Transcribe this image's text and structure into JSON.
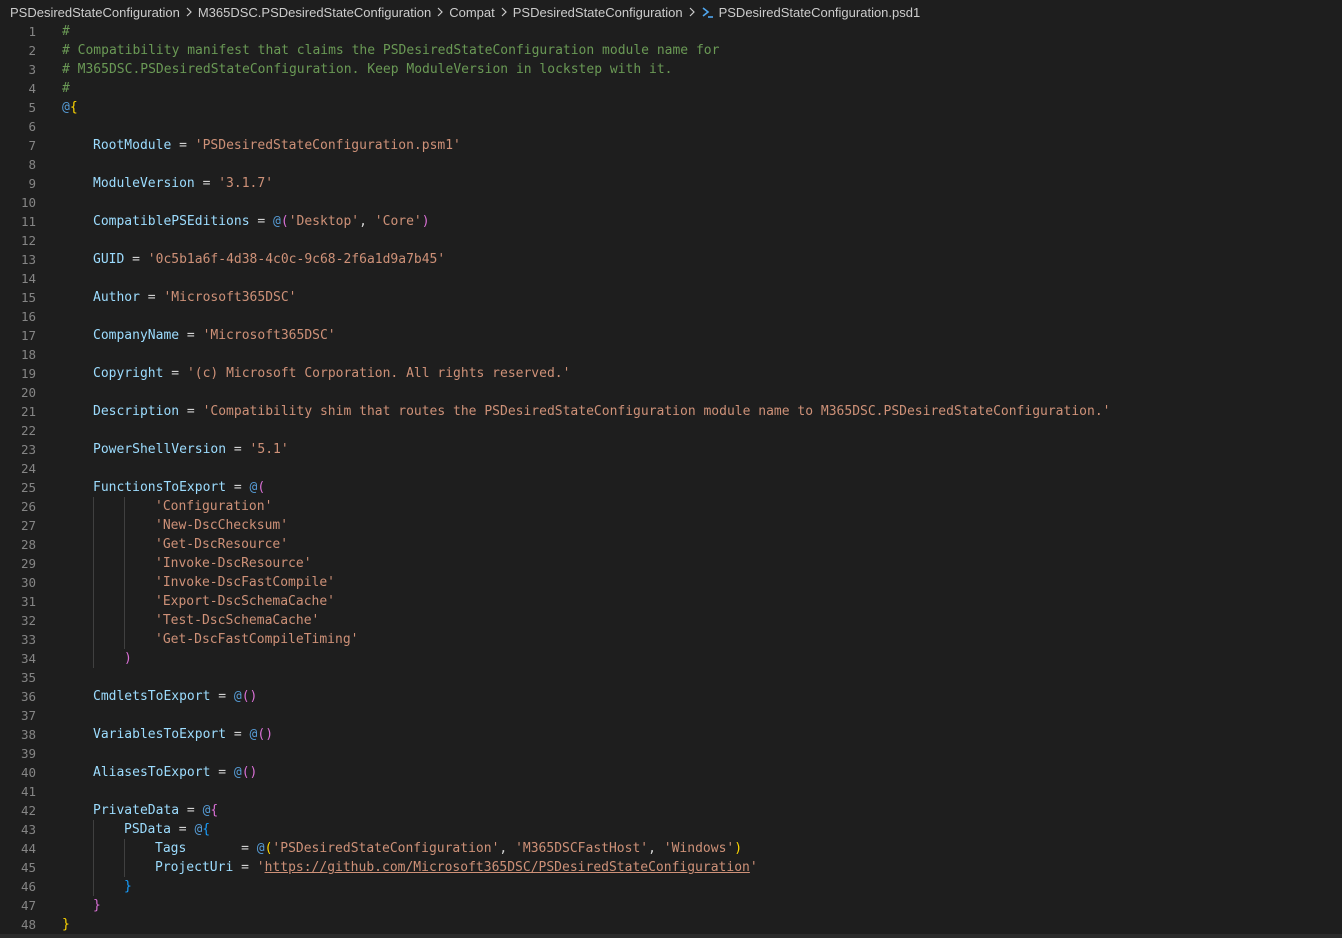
{
  "breadcrumb": {
    "items": [
      "PSDesiredStateConfiguration",
      "M365DSC.PSDesiredStateConfiguration",
      "Compat",
      "PSDesiredStateConfiguration"
    ],
    "file": "PSDesiredStateConfiguration.psd1",
    "file_icon": "powershell-icon"
  },
  "colors": {
    "background": "#1e1e1e",
    "comment": "#6a9955",
    "key": "#9cdcfe",
    "string": "#ce9178",
    "bracket_level1": "#ffd700",
    "bracket_level2": "#da70d6",
    "bracket_level3": "#179fff",
    "line_number": "#858585"
  },
  "editor": {
    "lines": [
      {
        "n": "1",
        "tokens": [
          [
            "c",
            "#"
          ]
        ]
      },
      {
        "n": "2",
        "tokens": [
          [
            "c",
            "# Compatibility manifest that claims the PSDesiredStateConfiguration module name for"
          ]
        ]
      },
      {
        "n": "3",
        "tokens": [
          [
            "c",
            "# M365DSC.PSDesiredStateConfiguration. Keep ModuleVersion in lockstep with it."
          ]
        ]
      },
      {
        "n": "4",
        "tokens": [
          [
            "c",
            "#"
          ]
        ]
      },
      {
        "n": "5",
        "tokens": [
          [
            "a",
            "@"
          ],
          [
            "b1",
            "{"
          ]
        ]
      },
      {
        "n": "6",
        "tokens": []
      },
      {
        "n": "7",
        "indent": 1,
        "tokens": [
          [
            "k",
            "RootModule"
          ],
          [
            "o",
            " = "
          ],
          [
            "s",
            "'PSDesiredStateConfiguration.psm1'"
          ]
        ]
      },
      {
        "n": "8",
        "tokens": []
      },
      {
        "n": "9",
        "indent": 1,
        "tokens": [
          [
            "k",
            "ModuleVersion"
          ],
          [
            "o",
            " = "
          ],
          [
            "s",
            "'3.1.7'"
          ]
        ]
      },
      {
        "n": "10",
        "tokens": []
      },
      {
        "n": "11",
        "indent": 1,
        "tokens": [
          [
            "k",
            "CompatiblePSEditions"
          ],
          [
            "o",
            " = "
          ],
          [
            "a",
            "@"
          ],
          [
            "b2",
            "("
          ],
          [
            "s",
            "'Desktop'"
          ],
          [
            "o",
            ", "
          ],
          [
            "s",
            "'Core'"
          ],
          [
            "b2",
            ")"
          ]
        ]
      },
      {
        "n": "12",
        "tokens": []
      },
      {
        "n": "13",
        "indent": 1,
        "tokens": [
          [
            "k",
            "GUID"
          ],
          [
            "o",
            " = "
          ],
          [
            "s",
            "'0c5b1a6f-4d38-4c0c-9c68-2f6a1d9a7b45'"
          ]
        ]
      },
      {
        "n": "14",
        "tokens": []
      },
      {
        "n": "15",
        "indent": 1,
        "tokens": [
          [
            "k",
            "Author"
          ],
          [
            "o",
            " = "
          ],
          [
            "s",
            "'Microsoft365DSC'"
          ]
        ]
      },
      {
        "n": "16",
        "tokens": []
      },
      {
        "n": "17",
        "indent": 1,
        "tokens": [
          [
            "k",
            "CompanyName"
          ],
          [
            "o",
            " = "
          ],
          [
            "s",
            "'Microsoft365DSC'"
          ]
        ]
      },
      {
        "n": "18",
        "tokens": []
      },
      {
        "n": "19",
        "indent": 1,
        "tokens": [
          [
            "k",
            "Copyright"
          ],
          [
            "o",
            " = "
          ],
          [
            "s",
            "'(c) Microsoft Corporation. All rights reserved.'"
          ]
        ]
      },
      {
        "n": "20",
        "tokens": []
      },
      {
        "n": "21",
        "indent": 1,
        "tokens": [
          [
            "k",
            "Description"
          ],
          [
            "o",
            " = "
          ],
          [
            "s",
            "'Compatibility shim that routes the PSDesiredStateConfiguration module name to M365DSC.PSDesiredStateConfiguration.'"
          ]
        ]
      },
      {
        "n": "22",
        "tokens": []
      },
      {
        "n": "23",
        "indent": 1,
        "tokens": [
          [
            "k",
            "PowerShellVersion"
          ],
          [
            "o",
            " = "
          ],
          [
            "s",
            "'5.1'"
          ]
        ]
      },
      {
        "n": "24",
        "tokens": []
      },
      {
        "n": "25",
        "indent": 1,
        "tokens": [
          [
            "k",
            "FunctionsToExport"
          ],
          [
            "o",
            " = "
          ],
          [
            "a",
            "@"
          ],
          [
            "b2",
            "("
          ]
        ]
      },
      {
        "n": "26",
        "indent": 3,
        "guides": [
          1,
          2
        ],
        "tokens": [
          [
            "s",
            "'Configuration'"
          ]
        ]
      },
      {
        "n": "27",
        "indent": 3,
        "guides": [
          1,
          2
        ],
        "tokens": [
          [
            "s",
            "'New-DscChecksum'"
          ]
        ]
      },
      {
        "n": "28",
        "indent": 3,
        "guides": [
          1,
          2
        ],
        "tokens": [
          [
            "s",
            "'Get-DscResource'"
          ]
        ]
      },
      {
        "n": "29",
        "indent": 3,
        "guides": [
          1,
          2
        ],
        "tokens": [
          [
            "s",
            "'Invoke-DscResource'"
          ]
        ]
      },
      {
        "n": "30",
        "indent": 3,
        "guides": [
          1,
          2
        ],
        "tokens": [
          [
            "s",
            "'Invoke-DscFastCompile'"
          ]
        ]
      },
      {
        "n": "31",
        "indent": 3,
        "guides": [
          1,
          2
        ],
        "tokens": [
          [
            "s",
            "'Export-DscSchemaCache'"
          ]
        ]
      },
      {
        "n": "32",
        "indent": 3,
        "guides": [
          1,
          2
        ],
        "tokens": [
          [
            "s",
            "'Test-DscSchemaCache'"
          ]
        ]
      },
      {
        "n": "33",
        "indent": 3,
        "guides": [
          1,
          2
        ],
        "tokens": [
          [
            "s",
            "'Get-DscFastCompileTiming'"
          ]
        ]
      },
      {
        "n": "34",
        "indent": 2,
        "guides": [
          1
        ],
        "tokens": [
          [
            "b2",
            ")"
          ]
        ]
      },
      {
        "n": "35",
        "tokens": []
      },
      {
        "n": "36",
        "indent": 1,
        "tokens": [
          [
            "k",
            "CmdletsToExport"
          ],
          [
            "o",
            " = "
          ],
          [
            "a",
            "@"
          ],
          [
            "b2",
            "()"
          ]
        ]
      },
      {
        "n": "37",
        "tokens": []
      },
      {
        "n": "38",
        "indent": 1,
        "tokens": [
          [
            "k",
            "VariablesToExport"
          ],
          [
            "o",
            " = "
          ],
          [
            "a",
            "@"
          ],
          [
            "b2",
            "()"
          ]
        ]
      },
      {
        "n": "39",
        "tokens": []
      },
      {
        "n": "40",
        "indent": 1,
        "tokens": [
          [
            "k",
            "AliasesToExport"
          ],
          [
            "o",
            " = "
          ],
          [
            "a",
            "@"
          ],
          [
            "b2",
            "()"
          ]
        ]
      },
      {
        "n": "41",
        "tokens": []
      },
      {
        "n": "42",
        "indent": 1,
        "tokens": [
          [
            "k",
            "PrivateData"
          ],
          [
            "o",
            " = "
          ],
          [
            "a",
            "@"
          ],
          [
            "b2",
            "{"
          ]
        ]
      },
      {
        "n": "43",
        "indent": 2,
        "guides": [
          1
        ],
        "tokens": [
          [
            "k",
            "PSData"
          ],
          [
            "o",
            " = "
          ],
          [
            "a",
            "@"
          ],
          [
            "b3",
            "{"
          ]
        ]
      },
      {
        "n": "44",
        "indent": 3,
        "guides": [
          1,
          2
        ],
        "tokens": [
          [
            "k",
            "Tags"
          ],
          [
            "o",
            "       = "
          ],
          [
            "a",
            "@"
          ],
          [
            "b1",
            "("
          ],
          [
            "s",
            "'PSDesiredStateConfiguration'"
          ],
          [
            "o",
            ", "
          ],
          [
            "s",
            "'M365DSCFastHost'"
          ],
          [
            "o",
            ", "
          ],
          [
            "s",
            "'Windows'"
          ],
          [
            "b1",
            ")"
          ]
        ]
      },
      {
        "n": "45",
        "indent": 3,
        "guides": [
          1,
          2
        ],
        "tokens": [
          [
            "k",
            "ProjectUri"
          ],
          [
            "o",
            " = "
          ],
          [
            "s",
            "'"
          ],
          [
            "u",
            "https://github.com/Microsoft365DSC/PSDesiredStateConfiguration"
          ],
          [
            "s",
            "'"
          ]
        ]
      },
      {
        "n": "46",
        "indent": 2,
        "guides": [
          1
        ],
        "tokens": [
          [
            "b3",
            "}"
          ]
        ]
      },
      {
        "n": "47",
        "indent": 1,
        "tokens": [
          [
            "b2",
            "}"
          ]
        ]
      },
      {
        "n": "48",
        "tokens": [
          [
            "b1",
            "}"
          ]
        ]
      }
    ]
  }
}
